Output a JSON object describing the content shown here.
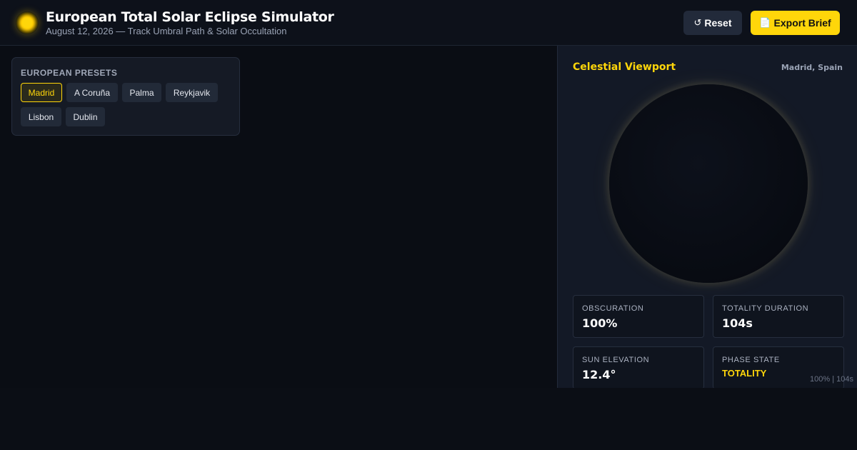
{
  "app": {
    "title": "European Total Solar Eclipse Simulator",
    "subtitle": "August 12, 2026 — Track Umbral Path & Solar Occultation"
  },
  "toolbar": {
    "reset_icon": "↺",
    "reset_label": "Reset",
    "export_icon": "📄",
    "export_label": "Export Brief"
  },
  "presets": {
    "title": "EUROPEAN PRESETS",
    "items": [
      {
        "label": "Madrid",
        "active": true
      },
      {
        "label": "A Coruña",
        "active": false
      },
      {
        "label": "Palma",
        "active": false
      },
      {
        "label": "Reykjavik",
        "active": false
      },
      {
        "label": "Lisbon",
        "active": false
      },
      {
        "label": "Dublin",
        "active": false
      }
    ]
  },
  "viewport": {
    "title": "Celestial Viewport",
    "location": "Madrid, Spain"
  },
  "stats": {
    "obscuration": {
      "label": "OBSCURATION",
      "value": "100%"
    },
    "totality_duration": {
      "label": "TOTALITY DURATION",
      "value": "104s"
    },
    "sun_elevation": {
      "label": "SUN ELEVATION",
      "value": "12.4°"
    },
    "phase_state": {
      "label": "PHASE STATE",
      "value": "TOTALITY"
    }
  },
  "readout": "100% | 104s",
  "colors": {
    "accent": "#ffd60a",
    "background": "#0b0e15",
    "panel": "#131926",
    "card": "#151a25"
  }
}
